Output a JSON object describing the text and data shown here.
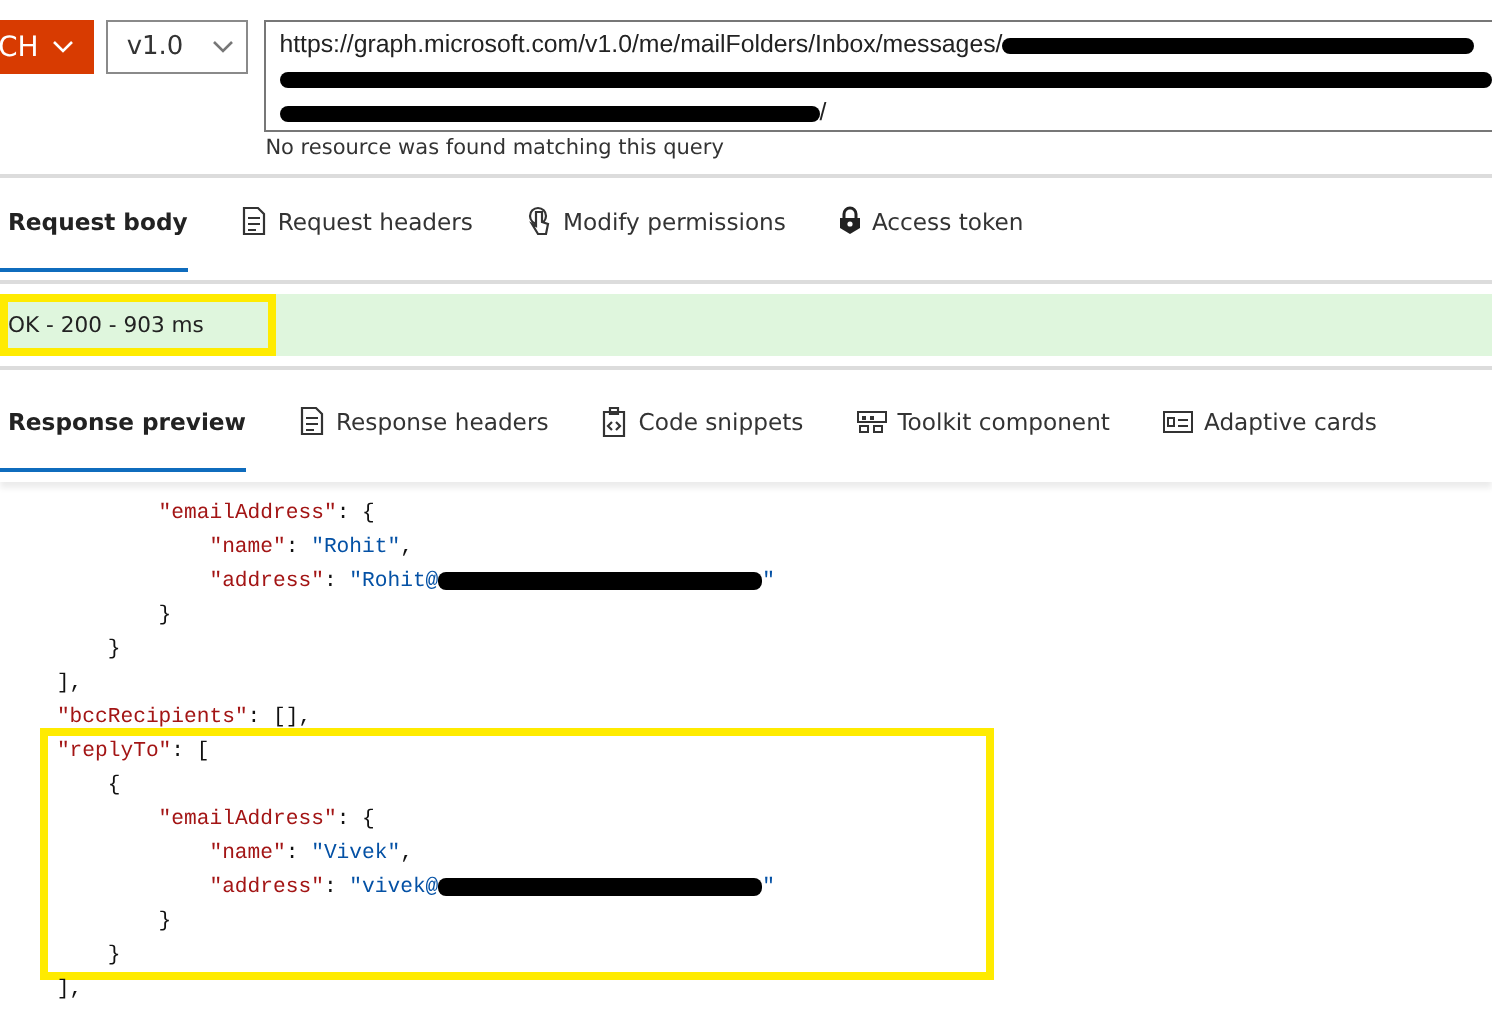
{
  "query": {
    "method": "CH",
    "version": "v1.0",
    "url": {
      "value": "https://graph.microsoft.com/v1.0/me/mailFolders/Inbox/messages/",
      "tail": "/",
      "redacted": true
    },
    "error": "No resource was found matching this query"
  },
  "request_tabs": [
    {
      "label": "Request body",
      "selected": true
    },
    {
      "label": "Request headers",
      "selected": false
    },
    {
      "label": "Modify permissions",
      "selected": false
    },
    {
      "label": "Access token",
      "selected": false
    }
  ],
  "status": {
    "text": "OK - 200 - 903 ms",
    "boxed": true
  },
  "response_tabs": [
    {
      "label": "Response preview",
      "selected": true
    },
    {
      "label": "Response headers",
      "selected": false
    },
    {
      "label": "Code snippets",
      "selected": false
    },
    {
      "label": "Toolkit component",
      "selected": false
    },
    {
      "label": "Adaptive cards",
      "selected": false
    }
  ],
  "code_blocks": [
    {
      "boxed": false,
      "lines": [
        {
          "text": "            \"emailAddress\": {"
        },
        {
          "text": "                \"name\": \"Rohit\","
        },
        {
          "text": "                \"address\": \"Rohit@",
          "redacted": true,
          "after": "\""
        },
        {
          "text": "            }"
        },
        {
          "text": "        }"
        },
        {
          "text": "    ],"
        },
        {
          "text": "    \"bccRecipients\": [],"
        }
      ]
    },
    {
      "boxed": true,
      "lines": [
        {
          "text": "    \"replyTo\": ["
        },
        {
          "text": "        {"
        },
        {
          "text": "            \"emailAddress\": {"
        },
        {
          "text": "                \"name\": \"Vivek\","
        },
        {
          "text": "                \"address\": \"vivek@",
          "redacted": true,
          "after": "\""
        },
        {
          "text": "            }"
        },
        {
          "text": "        }"
        }
      ]
    },
    {
      "boxed": false,
      "lines": [
        {
          "text": "    ],"
        }
      ]
    }
  ]
}
